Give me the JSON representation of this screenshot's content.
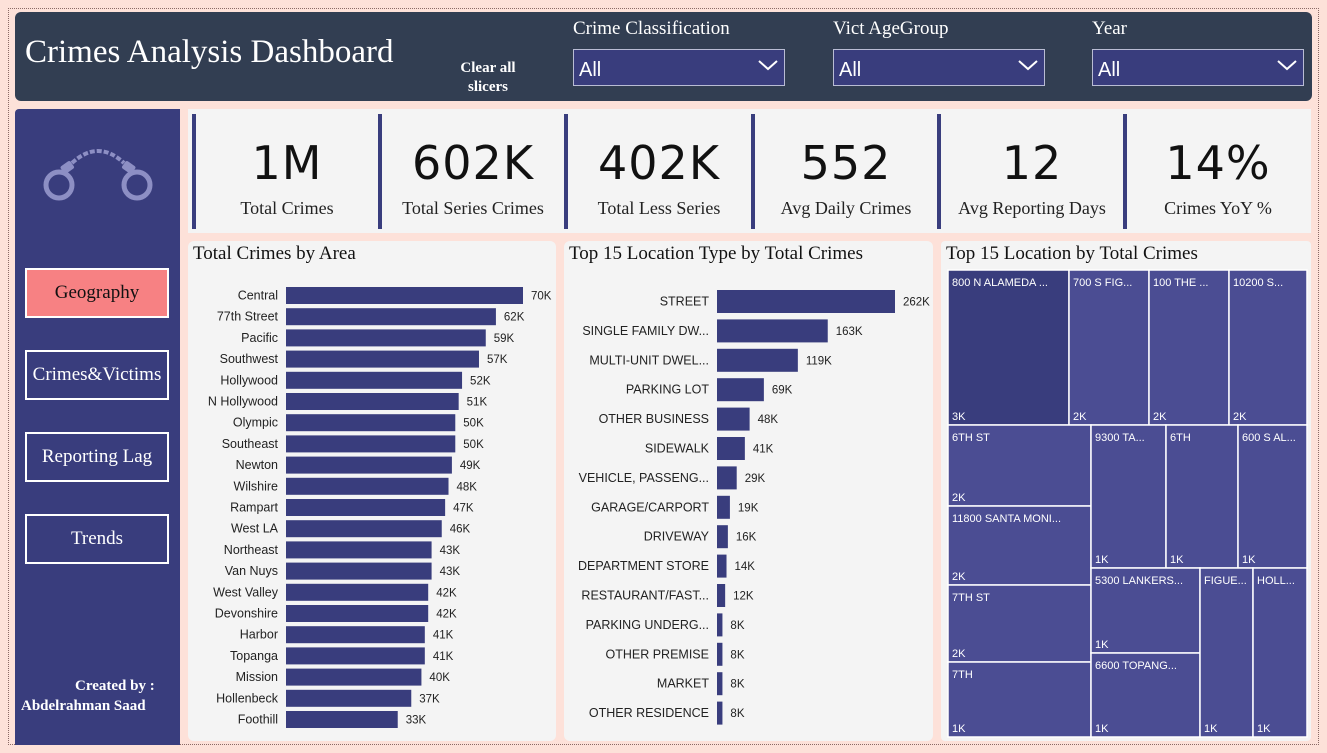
{
  "header": {
    "title": "Crimes Analysis Dashboard",
    "clear_line1": "Clear all",
    "clear_line2": "slicers",
    "slicers": [
      {
        "label": "Crime Classification",
        "value": "All"
      },
      {
        "label": "Vict AgeGroup",
        "value": "All"
      },
      {
        "label": "Year",
        "value": "All"
      }
    ]
  },
  "sidebar": {
    "nav": [
      {
        "label": "Geography",
        "active": true
      },
      {
        "label": "Crimes&Victims",
        "active": false
      },
      {
        "label": "Reporting Lag",
        "active": false
      },
      {
        "label": "Trends",
        "active": false
      }
    ],
    "credit_line1": "Created by :",
    "credit_line2": "Abdelrahman Saad"
  },
  "kpis": [
    {
      "value": "1M",
      "label": "Total Crimes"
    },
    {
      "value": "602K",
      "label": "Total Series Crimes"
    },
    {
      "value": "402K",
      "label": "Total Less Series"
    },
    {
      "value": "552",
      "label": "Avg Daily Crimes"
    },
    {
      "value": "12",
      "label": "Avg Reporting Days"
    },
    {
      "value": "14%",
      "label": "Crimes YoY %"
    }
  ],
  "colors": {
    "bar": "#393d7d",
    "treemap_primary": "#393d7d",
    "treemap_secondary": "#4b4d93",
    "active_nav": "#f78183"
  },
  "chart_data": [
    {
      "type": "bar",
      "orientation": "horizontal",
      "title": "Total Crimes by Area",
      "categories": [
        "Central",
        "77th Street",
        "Pacific",
        "Southwest",
        "Hollywood",
        "N Hollywood",
        "Olympic",
        "Southeast",
        "Newton",
        "Wilshire",
        "Rampart",
        "West LA",
        "Northeast",
        "Van Nuys",
        "West Valley",
        "Devonshire",
        "Harbor",
        "Topanga",
        "Mission",
        "Hollenbeck",
        "Foothill"
      ],
      "values": [
        70,
        62,
        59,
        57,
        52,
        51,
        50,
        50,
        49,
        48,
        47,
        46,
        43,
        43,
        42,
        42,
        41,
        41,
        40,
        37,
        33
      ],
      "labels": [
        "70K",
        "62K",
        "59K",
        "57K",
        "52K",
        "51K",
        "50K",
        "50K",
        "49K",
        "48K",
        "47K",
        "46K",
        "43K",
        "43K",
        "42K",
        "42K",
        "41K",
        "41K",
        "40K",
        "37K",
        "33K"
      ]
    },
    {
      "type": "bar",
      "orientation": "horizontal",
      "title": "Top 15 Location Type by Total Crimes",
      "categories": [
        "STREET",
        "SINGLE FAMILY DW...",
        "MULTI-UNIT DWEL...",
        "PARKING LOT",
        "OTHER BUSINESS",
        "SIDEWALK",
        "VEHICLE, PASSENG...",
        "GARAGE/CARPORT",
        "DRIVEWAY",
        "DEPARTMENT STORE",
        "RESTAURANT/FAST...",
        "PARKING UNDERG...",
        "OTHER PREMISE",
        "MARKET",
        "OTHER RESIDENCE"
      ],
      "values": [
        262,
        163,
        119,
        69,
        48,
        41,
        29,
        19,
        16,
        14,
        12,
        8,
        8,
        8,
        8
      ],
      "labels": [
        "262K",
        "163K",
        "119K",
        "69K",
        "48K",
        "41K",
        "29K",
        "19K",
        "16K",
        "14K",
        "12K",
        "8K",
        "8K",
        "8K",
        "8K"
      ]
    },
    {
      "type": "treemap",
      "title": "Top 15 Location by Total Crimes",
      "items": [
        {
          "name": "800 N ALAMEDA ...",
          "label": "3K",
          "value": 3
        },
        {
          "name": "700 S FIG...",
          "label": "2K",
          "value": 2
        },
        {
          "name": "100 THE ...",
          "label": "2K",
          "value": 2
        },
        {
          "name": "10200 S...",
          "label": "2K",
          "value": 2
        },
        {
          "name": "6TH ST",
          "label": "2K",
          "value": 2
        },
        {
          "name": "11800 SANTA MONI...",
          "label": "2K",
          "value": 2
        },
        {
          "name": "7TH ST",
          "label": "2K",
          "value": 2
        },
        {
          "name": "7TH",
          "label": "1K",
          "value": 1
        },
        {
          "name": "9300 TA...",
          "label": "1K",
          "value": 1
        },
        {
          "name": "6TH",
          "label": "1K",
          "value": 1
        },
        {
          "name": "600 S AL...",
          "label": "1K",
          "value": 1
        },
        {
          "name": "5300 LANKERS...",
          "label": "1K",
          "value": 1
        },
        {
          "name": "6600 TOPANG...",
          "label": "1K",
          "value": 1
        },
        {
          "name": "FIGUE...",
          "label": "1K",
          "value": 1
        },
        {
          "name": "HOLL...",
          "label": "1K",
          "value": 1
        }
      ]
    }
  ]
}
